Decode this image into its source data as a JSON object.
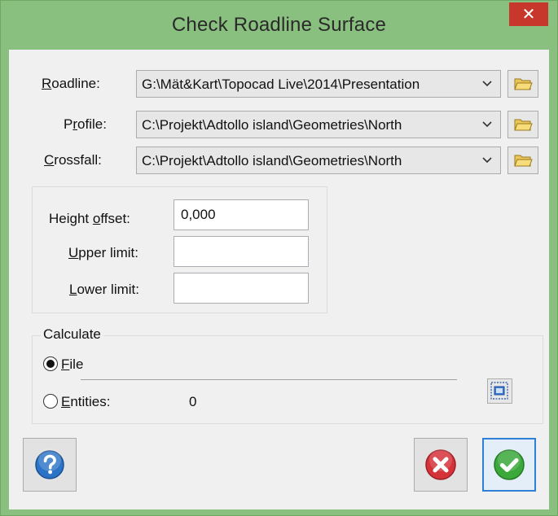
{
  "window": {
    "title": "Check Roadline Surface",
    "close_glyph": "✕"
  },
  "fields": {
    "roadline": {
      "label_u": "R",
      "label_rest": "oadline:",
      "value": "G:\\Mät&Kart\\Topocad Live\\2014\\Presentation"
    },
    "profile": {
      "label_pre": "P",
      "label_u": "r",
      "label_rest": "ofile:",
      "value": "C:\\Projekt\\Adtollo island\\Geometries\\North"
    },
    "crossfall": {
      "label_u": "C",
      "label_rest": "rossfall:",
      "value": "C:\\Projekt\\Adtollo island\\Geometries\\North"
    }
  },
  "offsets": {
    "height_offset": {
      "label_pre": "Height ",
      "label_u": "o",
      "label_rest": "ffset:",
      "value": "0,000"
    },
    "upper_limit": {
      "label_u": "U",
      "label_rest": "pper limit:",
      "value": ""
    },
    "lower_limit": {
      "label_u": "L",
      "label_rest": "ower limit:",
      "value": ""
    }
  },
  "calculate": {
    "title": "Calculate",
    "file": {
      "label_u": "F",
      "label_rest": "ile",
      "selected": true
    },
    "entities": {
      "label_u": "E",
      "label_rest": "ntities:",
      "count": "0",
      "selected": false
    }
  },
  "icons": {
    "folder": "folder-open-icon",
    "select": "select-entities-icon",
    "help": "help-icon",
    "cancel": "cancel-icon",
    "ok": "ok-icon"
  },
  "colors": {
    "title_bar": "#8ac07f",
    "close": "#c7372b",
    "help": "#2b73c6",
    "cancel": "#d5333a",
    "ok": "#3aa83a"
  }
}
